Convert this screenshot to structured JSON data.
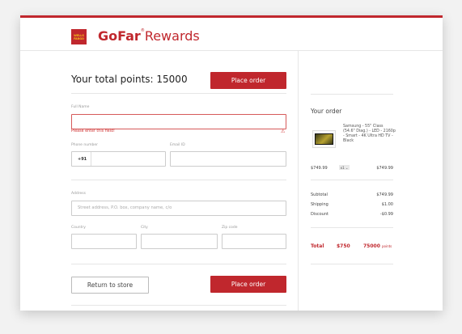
{
  "header": {
    "logo_text": "WELLS FARGO",
    "brand_go": "GoFar",
    "brand_reg": "®",
    "brand_rewards": "Rewards"
  },
  "form": {
    "points_title": "Your total points: 15000",
    "place_order_label": "Place order",
    "full_name_label": "Full Name",
    "full_name_value": "",
    "full_name_error": "Please enter this field!",
    "phone_label": "Phone number",
    "phone_prefix": "+91",
    "phone_value": "",
    "email_label": "Email ID",
    "email_value": "",
    "address_label": "Address",
    "address_placeholder": "Street address, P.O. box, company name, c/o",
    "country_label": "Country",
    "city_label": "City",
    "zip_label": "Zip code",
    "return_label": "Return to store",
    "place_order_bottom_label": "Place order"
  },
  "order": {
    "title": "Your order",
    "product_name": "Samsung - 55\" Class (54.6\" Diag.) - LED - 2160p - Smart - 4K Ultra HD TV - Black",
    "unit_price": "$749.99",
    "qty": "x1",
    "line_total": "$749.99",
    "subtotal_label": "Subtotal",
    "subtotal_value": "$749.99",
    "shipping_label": "Shipping",
    "shipping_value": "$1.00",
    "discount_label": "Discount",
    "discount_value": "-$0.99",
    "total_label": "Total",
    "total_value": "$750",
    "total_points": "75000",
    "total_points_unit": "points"
  },
  "colors": {
    "accent": "#c0272d",
    "error": "#d03030"
  }
}
